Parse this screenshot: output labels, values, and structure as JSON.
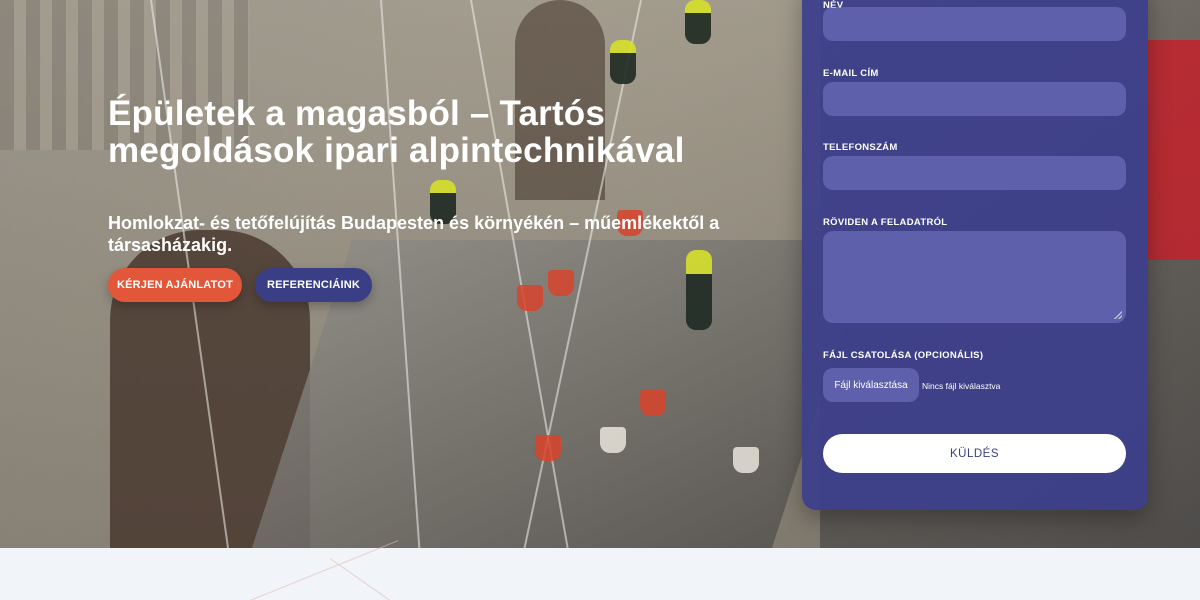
{
  "hero": {
    "title": "Épületek a magasból – Tartós megoldások ipari alpintechnikával",
    "subtitle": "Homlokzat- és tetőfelújítás Budapesten és környékén – műemlékektől a társasházakig.",
    "primary_button": "KÉRJEN AJÁNLATOT",
    "secondary_button": "REFERENCIÁINK"
  },
  "form": {
    "name_label": "NÉV",
    "email_label": "E-MAIL CÍM",
    "phone_label": "TELEFONSZÁM",
    "message_label": "RÖVIDEN A FELADATRÓL",
    "file_label": "FÁJL CSATOLÁSA (OPCIONÁLIS)",
    "file_button": "Fájl kiválasztása",
    "file_status": "Nincs fájl kiválasztva",
    "submit_label": "KÜLDÉS"
  },
  "colors": {
    "primary_accent": "#e2573a",
    "secondary_accent": "#3a3f85",
    "form_panel": "#3c3e8c"
  }
}
